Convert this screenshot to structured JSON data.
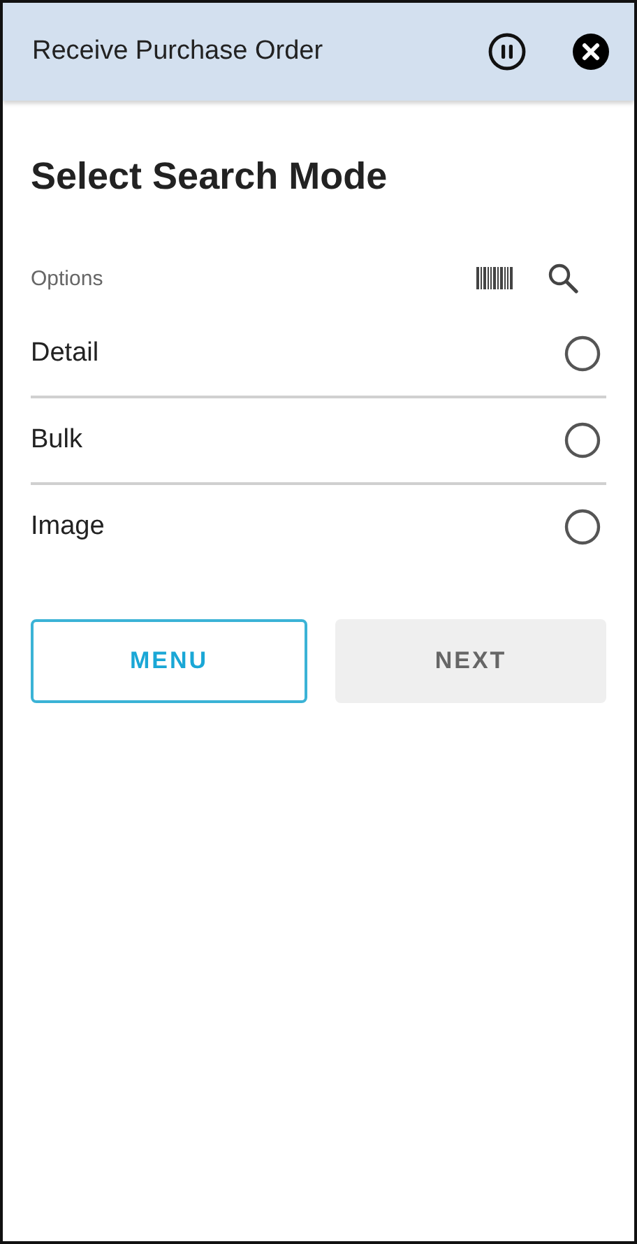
{
  "header": {
    "title": "Receive Purchase Order"
  },
  "heading": "Select Search Mode",
  "options_label": "Options",
  "options": [
    {
      "label": "Detail",
      "selected": false
    },
    {
      "label": "Bulk",
      "selected": false
    },
    {
      "label": "Image",
      "selected": false
    }
  ],
  "buttons": [
    {
      "label": "MENU",
      "disabled": false
    },
    {
      "label": "NEXT",
      "disabled": true
    }
  ]
}
